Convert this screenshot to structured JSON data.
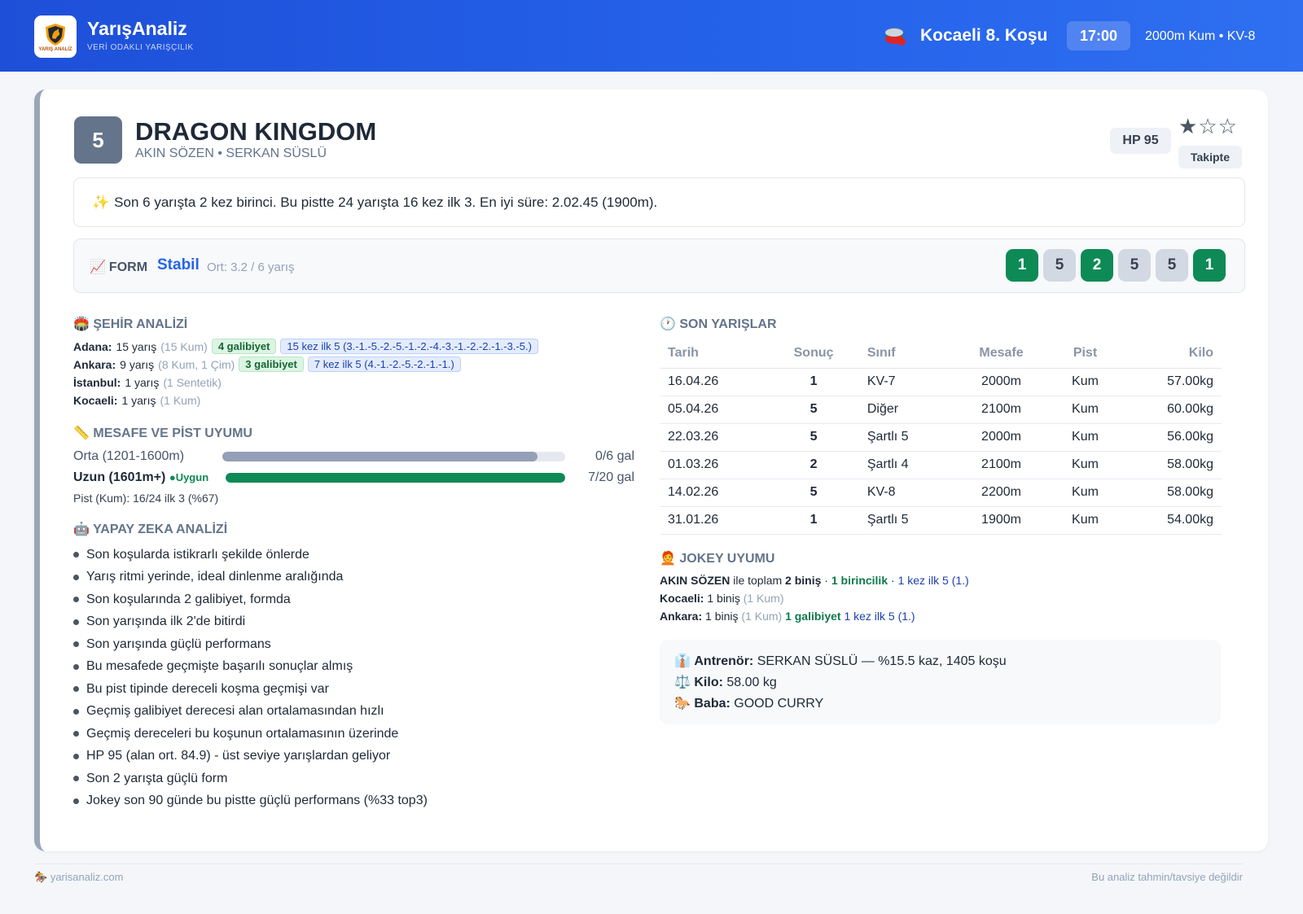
{
  "header": {
    "brand": "YarışAnaliz",
    "tagline": "VERİ ODAKLI YARIŞÇILIK",
    "logo_text": "YARIŞ ANALİZ",
    "race_title": "Kocaeli 8. Koşu",
    "time": "17:00",
    "race_info": "2000m Kum • KV-8"
  },
  "horse": {
    "number": "5",
    "name": "DRAGON KINGDOM",
    "subtitle": "AKIN SÖZEN • SERKAN SÜSLÜ",
    "hp": "HP 95",
    "rating": 1,
    "rating_max": 3,
    "follow_label": "Takipte"
  },
  "summary": "Son 6 yarışta 2 kez birinci. Bu pistte 24 yarışta 16 kez ilk 3. En iyi süre: 2.02.45 (1900m).",
  "form": {
    "label": "FORM",
    "state": "Stabil",
    "avg": "Ort: 3.2 / 6 yarış",
    "results": [
      "1",
      "5",
      "2",
      "5",
      "5",
      "1"
    ],
    "win_color": "#0e8a56",
    "other_color": "#d3d9e2"
  },
  "city": {
    "title": "ŞEHİR ANALİZİ",
    "rows": [
      {
        "city": "Adana:",
        "count": "15 yarış",
        "detail": "(15 Kum)",
        "wins": "4 galibiyet",
        "top5": "15 kez ilk 5 (3.-1.-5.-2.-5.-1.-2.-4.-3.-1.-2.-2.-1.-3.-5.)"
      },
      {
        "city": "Ankara:",
        "count": "9 yarış",
        "detail": "(8 Kum, 1 Çim)",
        "wins": "3 galibiyet",
        "top5": "7 kez ilk 5 (4.-1.-2.-5.-2.-1.-1.)"
      },
      {
        "city": "İstanbul:",
        "count": "1 yarış",
        "detail": "(1 Sentetik)",
        "wins": "",
        "top5": ""
      },
      {
        "city": "Kocaeli:",
        "count": "1 yarış",
        "detail": "(1 Kum)",
        "wins": "",
        "top5": ""
      }
    ]
  },
  "distance": {
    "title": "MESAFE VE PİST UYUMU",
    "rows": [
      {
        "label": "Orta (1201-1600m)",
        "badge": "",
        "value": "0/6 gal",
        "fill": 0.92,
        "color": "#94a0b8"
      },
      {
        "label": "Uzun (1601m+)",
        "badge": "Uygun",
        "value": "7/20 gal",
        "fill": 1.0,
        "color": "#0e8a56"
      }
    ],
    "track_note": "Pist (Kum): 16/24 ilk 3 (%67)"
  },
  "ai": {
    "title": "YAPAY ZEKA ANALİZİ",
    "items": [
      "Son koşularda istikrarlı şekilde önlerde",
      "Yarış ritmi yerinde, ideal dinlenme aralığında",
      "Son koşularında 2 galibiyet, formda",
      "Son yarışında ilk 2'de bitirdi",
      "Son yarışında güçlü performans",
      "Bu mesafede geçmişte başarılı sonuçlar almış",
      "Bu pist tipinde dereceli koşma geçmişi var",
      "Geçmiş galibiyet derecesi alan ortalamasından hızlı",
      "Geçmiş dereceleri bu koşunun ortalamasının üzerinde",
      "HP 95 (alan ort. 84.9) - üst seviye yarışlardan geliyor",
      "Son 2 yarışta güçlü form",
      "Jokey son 90 günde bu pistte güçlü performans (%33 top3)"
    ]
  },
  "recent": {
    "title": "SON YARIŞLAR",
    "columns": [
      "Tarih",
      "Sonuç",
      "Sınıf",
      "Mesafe",
      "Pist",
      "Kilo"
    ],
    "rows": [
      {
        "date": "16.04.26",
        "result": "1",
        "class": "KV-7",
        "distance": "2000m",
        "track": "Kum",
        "weight": "57.00kg"
      },
      {
        "date": "05.04.26",
        "result": "5",
        "class": "Diğer",
        "distance": "2100m",
        "track": "Kum",
        "weight": "60.00kg"
      },
      {
        "date": "22.03.26",
        "result": "5",
        "class": "Şartlı 5",
        "distance": "2000m",
        "track": "Kum",
        "weight": "56.00kg"
      },
      {
        "date": "01.03.26",
        "result": "2",
        "class": "Şartlı 4",
        "distance": "2100m",
        "track": "Kum",
        "weight": "58.00kg"
      },
      {
        "date": "14.02.26",
        "result": "5",
        "class": "KV-8",
        "distance": "2200m",
        "track": "Kum",
        "weight": "58.00kg"
      },
      {
        "date": "31.01.26",
        "result": "1",
        "class": "Şartlı 5",
        "distance": "1900m",
        "track": "Kum",
        "weight": "54.00kg"
      }
    ]
  },
  "jockey": {
    "title": "JOKEY UYUMU",
    "name": "AKIN SÖZEN",
    "total_prefix": "ile toplam",
    "total_rides": "2 biniş",
    "total_wins": "1 birincilik",
    "total_top5": "1 kez ilk 5 (1.)",
    "rows": [
      {
        "city": "Kocaeli:",
        "rides": "1 biniş",
        "detail": "(1 Kum)",
        "wins": "",
        "top5": ""
      },
      {
        "city": "Ankara:",
        "rides": "1 biniş",
        "detail": "(1 Kum)",
        "wins": "1 galibiyet",
        "top5": "1 kez ilk 5 (1.)"
      }
    ]
  },
  "details": {
    "trainer_label": "Antrenör:",
    "trainer_value": "SERKAN SÜSLÜ — %15.5 kaz, 1405 koşu",
    "weight_label": "Kilo:",
    "weight_value": "58.00 kg",
    "sire_label": "Baba:",
    "sire_value": "GOOD CURRY"
  },
  "footer": {
    "site": "yarisanaliz.com",
    "disclaimer": "Bu analiz tahmin/tavsiye değildir"
  }
}
